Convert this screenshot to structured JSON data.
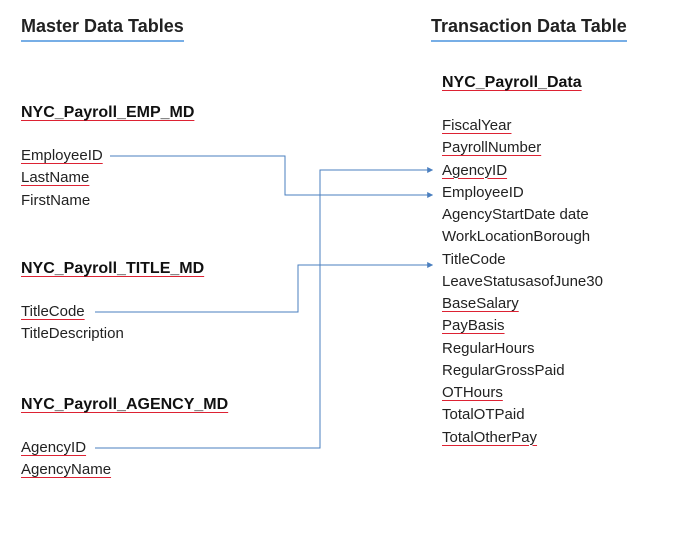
{
  "headings": {
    "left": "Master Data Tables",
    "right": "Transaction Data Table"
  },
  "master_tables": {
    "emp": {
      "title": "NYC_Payroll_EMP_MD",
      "fields": [
        "EmployeeID",
        "LastName",
        "FirstName"
      ]
    },
    "title_md": {
      "title": "NYC_Payroll_TITLE_MD",
      "fields": [
        "TitleCode",
        "TitleDescription"
      ]
    },
    "agency": {
      "title": "NYC_Payroll_AGENCY_MD",
      "fields": [
        "AgencyID",
        "AgencyName"
      ]
    }
  },
  "transaction_table": {
    "title": "NYC_Payroll_Data",
    "fields": [
      "FiscalYear",
      "PayrollNumber",
      "AgencyID",
      "EmployeeID",
      "AgencyStartDate date",
      "WorkLocationBorough",
      "TitleCode",
      "LeaveStatusasofJune30",
      "BaseSalary",
      "PayBasis",
      "RegularHours",
      "RegularGrossPaid",
      "OTHours",
      "TotalOTPaid",
      "TotalOtherPay"
    ]
  },
  "underlined_fields": {
    "master.emp": [
      0,
      1
    ],
    "master.title_md": [
      0
    ],
    "master.agency": [
      0,
      1
    ],
    "transaction": [
      0,
      1,
      2,
      8,
      9,
      12,
      14
    ]
  },
  "joins": [
    {
      "from_table": "emp",
      "from_field": "EmployeeID",
      "to_field": "EmployeeID"
    },
    {
      "from_table": "title_md",
      "from_field": "TitleCode",
      "to_field": "TitleCode"
    },
    {
      "from_table": "agency",
      "from_field": "AgencyID",
      "to_field": "AgencyID"
    }
  ]
}
